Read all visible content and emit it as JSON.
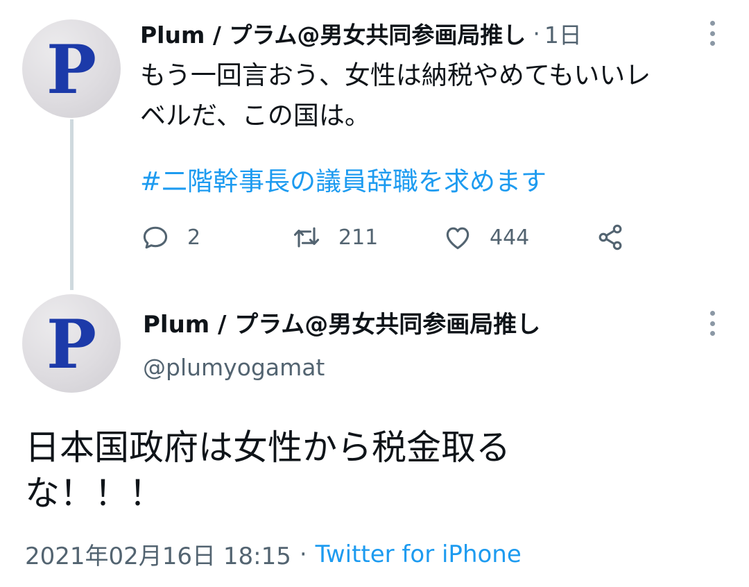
{
  "tweet1": {
    "avatar_letter": "P",
    "display_name": "Plum / プラム@男女共同参画局推し",
    "time_sep": "·",
    "time": "1日",
    "text_line1": "もう一回言おう、女性は納税やめてもいいレ",
    "text_line2": "ベルだ、この国は。",
    "hashtag": "#二階幹事長の議員辞職を求めます",
    "actions": {
      "reply_count": "2",
      "retweet_count": "211",
      "like_count": "444"
    }
  },
  "tweet2": {
    "avatar_letter": "P",
    "display_name": "Plum / プラム@男女共同参画局推し",
    "handle": "@plumyogamat",
    "text_line1": "日本国政府は女性から税金取る",
    "text_line2": "な！！！",
    "timestamp": "2021年02月16日 18:15",
    "meta_sep": "·",
    "source": "Twitter for iPhone"
  },
  "colors": {
    "link": "#1d9bf0",
    "secondary_text": "#536471",
    "avatar_letter": "#1c3aa9",
    "thread_line": "#cfd9de"
  },
  "icons": [
    "reply-icon",
    "retweet-icon",
    "like-icon",
    "share-icon",
    "more-icon"
  ]
}
